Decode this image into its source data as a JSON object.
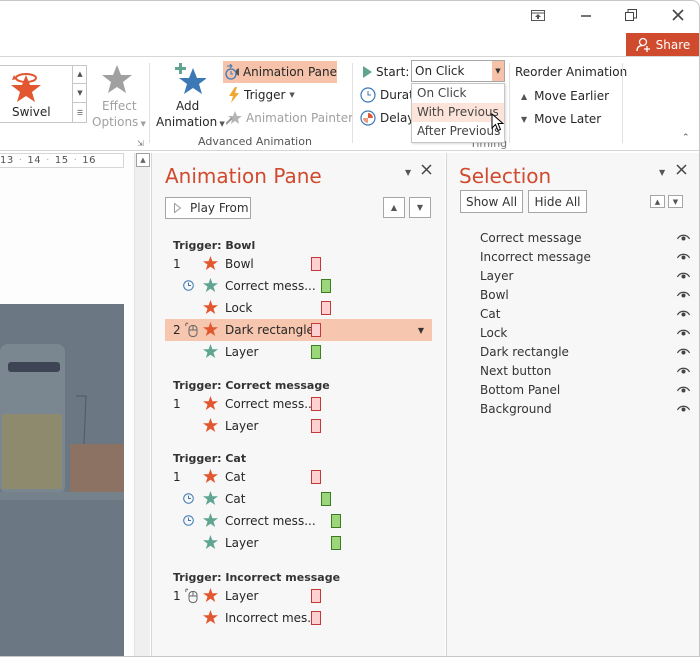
{
  "window": {
    "controls": [
      "ribbon-display-options",
      "minimize",
      "restore",
      "close"
    ],
    "share_label": "Share"
  },
  "ribbon": {
    "gallery": {
      "selected_effect": "Swivel"
    },
    "effect_options": {
      "line1": "Effect",
      "line2": "Options"
    },
    "add_animation": {
      "line1": "Add",
      "line2": "Animation"
    },
    "animation_pane_label": "Animation Pane",
    "trigger_label": "Trigger",
    "animation_painter_label": "Animation Painter",
    "advanced_group_label": "Advanced Animation",
    "timing": {
      "start_label": "Start:",
      "start_value": "On Click",
      "duration_label": "Durati",
      "delay_label": "Delay:",
      "group_label": "Timing",
      "start_options": [
        "On Click",
        "With Previous",
        "After Previous"
      ],
      "highlighted_option": "With Previous"
    },
    "reorder": {
      "title": "Reorder Animation",
      "move_earlier": "Move Earlier",
      "move_later": "Move Later"
    }
  },
  "ruler": {
    "ticks": [
      "13",
      "14",
      "15",
      "16"
    ]
  },
  "animation_pane": {
    "title": "Animation Pane",
    "play_from_label": "Play From",
    "groups": [
      {
        "trigger": "Trigger: Bowl",
        "items": [
          {
            "num": "1",
            "marker": "",
            "star": "entrance",
            "name": "Bowl",
            "bar": "red",
            "offset": 0,
            "selected": false
          },
          {
            "num": "",
            "marker": "clock",
            "star": "exit",
            "name": "Correct mess...",
            "bar": "green",
            "offset": 1,
            "selected": false
          },
          {
            "num": "",
            "marker": "",
            "star": "entrance",
            "name": "Lock",
            "bar": "red",
            "offset": 1,
            "selected": false
          },
          {
            "num": "2",
            "marker": "mouse",
            "star": "entrance",
            "name": "Dark rectangle",
            "bar": "red",
            "offset": 0,
            "selected": true
          },
          {
            "num": "",
            "marker": "",
            "star": "exit",
            "name": "Layer",
            "bar": "green",
            "offset": 0,
            "selected": false
          }
        ]
      },
      {
        "trigger": "Trigger: Correct message",
        "items": [
          {
            "num": "1",
            "marker": "",
            "star": "entrance",
            "name": "Correct mess...",
            "bar": "red",
            "offset": 0,
            "selected": false
          },
          {
            "num": "",
            "marker": "",
            "star": "entrance",
            "name": "Layer",
            "bar": "red",
            "offset": 0,
            "selected": false
          }
        ]
      },
      {
        "trigger": "Trigger: Cat",
        "items": [
          {
            "num": "1",
            "marker": "",
            "star": "entrance",
            "name": "Cat",
            "bar": "red",
            "offset": 0,
            "selected": false
          },
          {
            "num": "",
            "marker": "clock",
            "star": "exit",
            "name": "Cat",
            "bar": "green",
            "offset": 1,
            "selected": false
          },
          {
            "num": "",
            "marker": "clock",
            "star": "exit",
            "name": "Correct mess...",
            "bar": "green",
            "offset": 2,
            "selected": false
          },
          {
            "num": "",
            "marker": "",
            "star": "exit",
            "name": "Layer",
            "bar": "green",
            "offset": 2,
            "selected": false
          }
        ]
      },
      {
        "trigger": "Trigger: Incorrect message",
        "items": [
          {
            "num": "1",
            "marker": "mouse",
            "star": "entrance",
            "name": "Layer",
            "bar": "red",
            "offset": 0,
            "selected": false
          },
          {
            "num": "",
            "marker": "",
            "star": "entrance",
            "name": "Incorrect mes...",
            "bar": "red",
            "offset": 0,
            "selected": false
          }
        ]
      }
    ]
  },
  "selection_pane": {
    "title": "Selection",
    "show_all_label": "Show All",
    "hide_all_label": "Hide All",
    "items": [
      "Correct message",
      "Incorrect message",
      "Layer",
      "Bowl",
      "Cat",
      "Lock",
      "Dark rectangle",
      "Next button",
      "Bottom Panel",
      "Background"
    ]
  },
  "colors": {
    "accent": "#d04a2d",
    "entrance_star": "#e2572f",
    "exit_star": "#5fa591",
    "selected_row": "#f7c6ae"
  }
}
